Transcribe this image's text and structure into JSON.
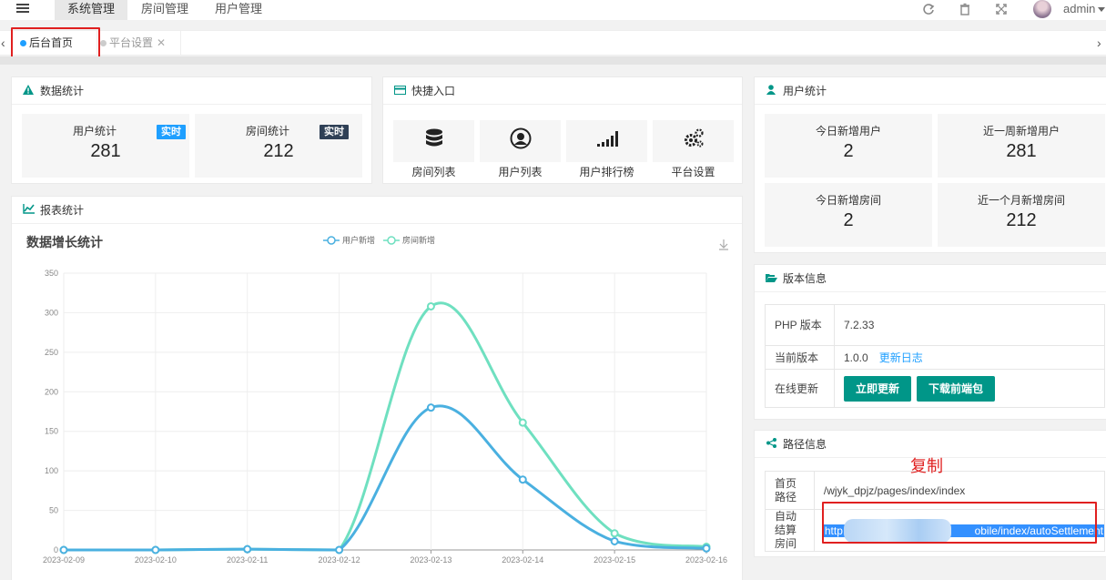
{
  "header": {
    "nav": [
      "系统管理",
      "房间管理",
      "用户管理"
    ],
    "user": "admin",
    "icons": [
      "menu-icon",
      "refresh-icon",
      "trash-icon",
      "fullscreen-icon"
    ]
  },
  "tabs": [
    {
      "label": "后台首页",
      "active": true
    },
    {
      "label": "平台设置",
      "active": false,
      "close": "✕"
    }
  ],
  "data_stats": {
    "title": "数据统计",
    "items": [
      {
        "label": "用户统计",
        "value": "281",
        "badge": "实时",
        "badge_color": "#1e9fff"
      },
      {
        "label": "房间统计",
        "value": "212",
        "badge": "实时",
        "badge_color": "#2f4056"
      }
    ]
  },
  "quick": {
    "title": "快捷入口",
    "items": [
      "房间列表",
      "用户列表",
      "用户排行榜",
      "平台设置"
    ]
  },
  "user_stats": {
    "title": "用户统计",
    "items": [
      {
        "label": "今日新增用户",
        "value": "2"
      },
      {
        "label": "近一周新增用户",
        "value": "281"
      },
      {
        "label": "今日新增房间",
        "value": "2"
      },
      {
        "label": "近一个月新增房间",
        "value": "212"
      }
    ]
  },
  "report": {
    "title": "报表统计"
  },
  "chart_data": {
    "type": "line",
    "title": "数据增长统计",
    "categories": [
      "2023-02-09",
      "2023-02-10",
      "2023-02-11",
      "2023-02-12",
      "2023-02-13",
      "2023-02-14",
      "2023-02-15",
      "2023-02-16"
    ],
    "series": [
      {
        "name": "用户新增",
        "values": [
          0,
          0,
          1,
          0,
          180,
          89,
          11,
          2
        ],
        "color": "#4ab0e0"
      },
      {
        "name": "房间新增",
        "values": [
          0,
          0,
          1,
          0,
          308,
          161,
          21,
          4
        ],
        "color": "#6fe0c0"
      }
    ],
    "yticks": [
      0,
      50,
      100,
      150,
      200,
      250,
      300,
      350
    ],
    "ylim": [
      0,
      350
    ],
    "smooth": true,
    "grid": true,
    "legend": "top-center"
  },
  "version": {
    "title": "版本信息",
    "php_label": "PHP 版本",
    "php_value": "7.2.33",
    "current_label": "当前版本",
    "current_value": "1.0.0",
    "changelog": "更新日志",
    "update_label": "在线更新",
    "btn_update": "立即更新",
    "btn_download": "下载前端包"
  },
  "paths": {
    "title": "路径信息",
    "home_label": "首页路径",
    "home_value": "/wjyk_dpjz/pages/index/index",
    "auto_label": "自动结算房间",
    "auto_value_start": "http:/",
    "auto_value_end": "obile/index/autoSettlement",
    "annotation": "复制"
  }
}
